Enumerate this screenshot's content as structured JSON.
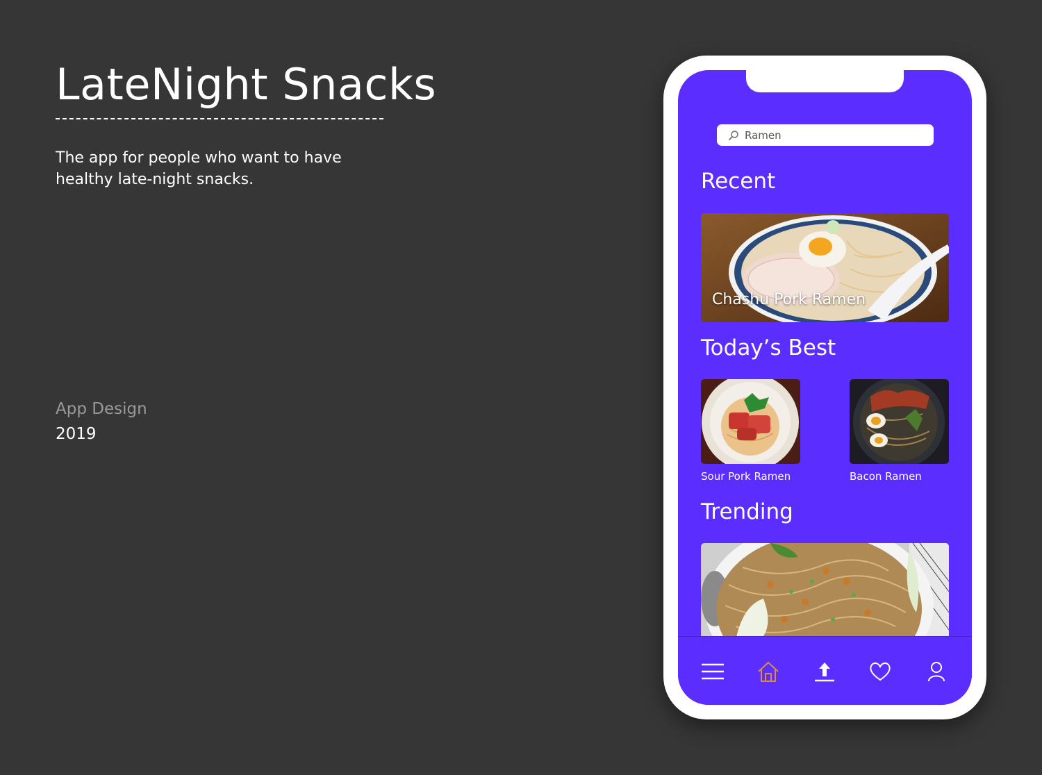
{
  "project": {
    "title": "LateNight Snacks",
    "tagline": "The app for people who want to have healthy late-night snacks.",
    "category": "App Design",
    "year": "2019"
  },
  "app": {
    "search": {
      "value": "Ramen",
      "icon": "search-icon"
    },
    "sections": {
      "recent": "Recent",
      "todays_best": "Today’s Best",
      "trending": "Trending"
    },
    "recent_card": {
      "caption": "Chashu Pork Ramen"
    },
    "todays_best": [
      {
        "label": "Sour Pork Ramen"
      },
      {
        "label": "Bacon Ramen"
      }
    ],
    "nav": [
      {
        "icon": "menu-icon",
        "active": false
      },
      {
        "icon": "home-icon",
        "active": true
      },
      {
        "icon": "upload-icon",
        "active": false
      },
      {
        "icon": "heart-icon",
        "active": false
      },
      {
        "icon": "profile-icon",
        "active": false
      }
    ],
    "colors": {
      "background": "#363636",
      "screen": "#5b2dff",
      "active_nav": "#d98f3a"
    }
  }
}
